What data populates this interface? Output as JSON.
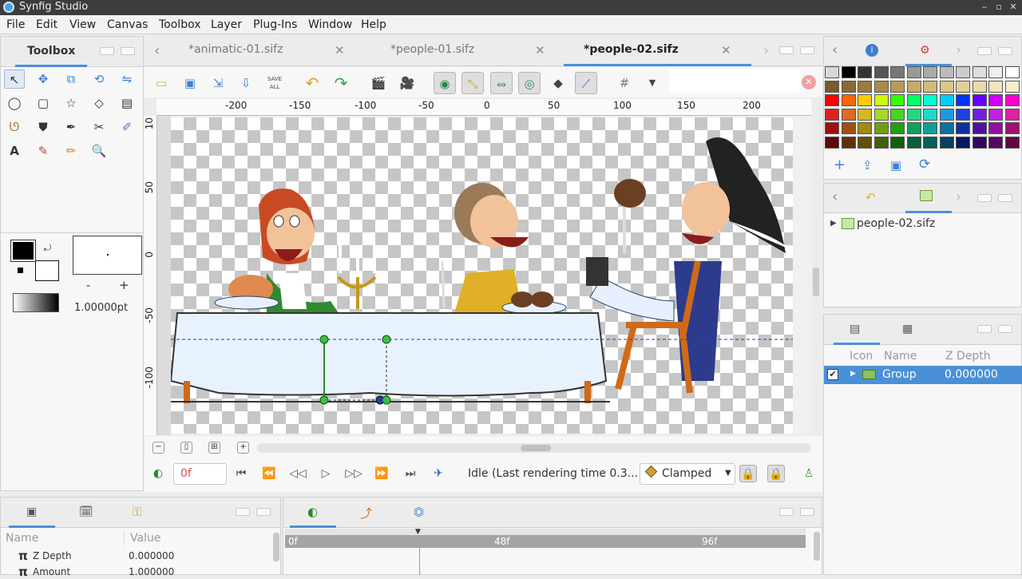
{
  "window": {
    "title": "Synfig Studio",
    "controls": [
      "‒",
      "▫",
      "✕"
    ]
  },
  "menu": [
    "File",
    "Edit",
    "View",
    "Canvas",
    "Toolbox",
    "Layer",
    "Plug-Ins",
    "Window",
    "Help"
  ],
  "toolbox": {
    "title": "Toolbox",
    "width_value": "1.00000pt",
    "minus": "-",
    "plus": "+"
  },
  "doc_tabs": [
    {
      "label": "*animatic-01.sifz"
    },
    {
      "label": "*people-01.sifz"
    },
    {
      "label": "*people-02.sifz"
    }
  ],
  "canvas_toolbar": {
    "save_all": "SAVE ALL"
  },
  "ruler": {
    "h_ticks": [
      "-200",
      "-150",
      "-100",
      "-50",
      "0",
      "50",
      "100",
      "150",
      "200"
    ],
    "v_ticks": [
      "10",
      "50",
      "0",
      "-50",
      "-100"
    ]
  },
  "playback": {
    "frame": "0f",
    "status": "Idle (Last rendering time 0.3...",
    "interpolation": "Clamped"
  },
  "library": {
    "file": "people-02.sifz"
  },
  "layers": {
    "headers": {
      "icon": "Icon",
      "name": "Name",
      "zdepth": "Z Depth"
    },
    "rows": [
      {
        "name": "Group",
        "zdepth": "0.000000"
      }
    ]
  },
  "params": {
    "headers": {
      "name": "Name",
      "value": "Value"
    },
    "rows": [
      {
        "name": "Z Depth",
        "value": "0.000000"
      },
      {
        "name": "Amount",
        "value": "1.000000"
      }
    ]
  },
  "timetrack": {
    "marks": [
      "0f",
      "48f",
      "96f"
    ]
  },
  "palette_colors": [
    [
      "#d8d8d8",
      "#000000",
      "#333333",
      "#555555",
      "#777777",
      "#999999",
      "#aaaaaa",
      "#bbbbbb",
      "#cccccc",
      "#dddddd",
      "#eeeeee",
      "#ffffff"
    ],
    [
      "#7a5a2e",
      "#8a6a35",
      "#9a7b3c",
      "#aa8a48",
      "#b89a58",
      "#c6aa68",
      "#d3b97a",
      "#dcc48a",
      "#e4cf9a",
      "#ecd9aa",
      "#f2e3bb",
      "#f8eecc"
    ],
    [
      "#ff0000",
      "#ff6600",
      "#ffcc00",
      "#ccff00",
      "#33ff00",
      "#00ff66",
      "#00ffcc",
      "#00ccff",
      "#0033ff",
      "#6600ff",
      "#cc00ff",
      "#ff00cc"
    ],
    [
      "#e02020",
      "#e06a20",
      "#d8b820",
      "#a8d820",
      "#40d820",
      "#20d880",
      "#20d8c8",
      "#2098e0",
      "#2040e0",
      "#7020e0",
      "#c020e0",
      "#e020a0"
    ],
    [
      "#a01010",
      "#a05010",
      "#a08a10",
      "#70a010",
      "#20a010",
      "#10a060",
      "#10a098",
      "#1070a0",
      "#1030a0",
      "#5010a0",
      "#9010a0",
      "#a01070"
    ],
    [
      "#600808",
      "#603008",
      "#605008",
      "#406008",
      "#106008",
      "#086038",
      "#086058",
      "#084060",
      "#081860",
      "#300860",
      "#580860",
      "#600840"
    ]
  ]
}
